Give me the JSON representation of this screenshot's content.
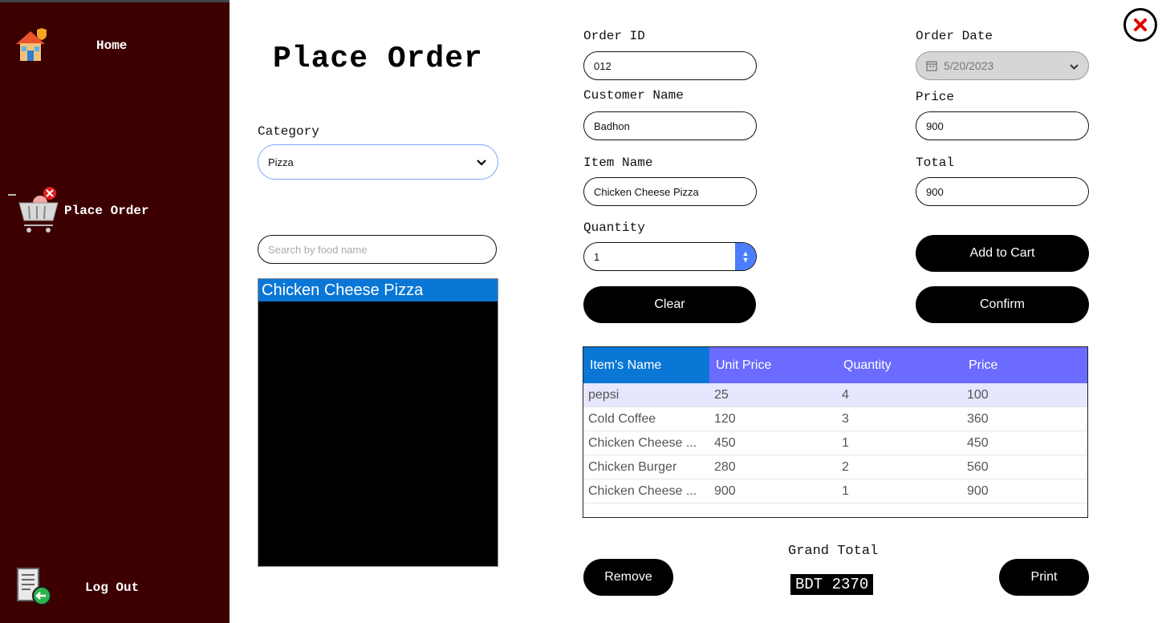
{
  "sidebar": {
    "home_label": "Home",
    "place_order_label": "Place Order",
    "logout_label": "Log Out"
  },
  "page": {
    "title": "Place Order"
  },
  "left_panel": {
    "category_label": "Category",
    "category_value": "Pizza",
    "search_placeholder": "Search by food name",
    "food_list": [
      "Chicken Cheese Pizza"
    ]
  },
  "form": {
    "order_id_label": "Order ID",
    "order_id_value": "012",
    "customer_name_label": "Customer Name",
    "customer_name_value": "Badhon",
    "item_name_label": "Item Name",
    "item_name_value": "Chicken Cheese Pizza",
    "quantity_label": "Quantity",
    "quantity_value": "1",
    "order_date_label": "Order Date",
    "order_date_value": "5/20/2023",
    "price_label": "Price",
    "price_value": "900",
    "total_label": "Total",
    "total_value": "900"
  },
  "buttons": {
    "add_to_cart": "Add to Cart",
    "clear": "Clear",
    "confirm": "Confirm",
    "remove": "Remove",
    "print": "Print"
  },
  "cart_table": {
    "columns": [
      "Item's Name",
      "Unit Price",
      "Quantity",
      "Price"
    ],
    "rows": [
      [
        "pepsi",
        "25",
        "4",
        "100"
      ],
      [
        "Cold Coffee",
        "120",
        "3",
        "360"
      ],
      [
        "Chicken Cheese ...",
        "450",
        "1",
        "450"
      ],
      [
        "Chicken Burger",
        "280",
        "2",
        "560"
      ],
      [
        "Chicken Cheese ...",
        "900",
        "1",
        "900"
      ]
    ]
  },
  "grand_total": {
    "label": "Grand Total",
    "value": "BDT 2370"
  },
  "colors": {
    "sidebar_bg": "#3c0000",
    "header_bg": "#6b6bff",
    "header_first_col_bg": "#0a77d6",
    "selected_list_bg": "#0a77d6",
    "close_red": "#e00000"
  }
}
